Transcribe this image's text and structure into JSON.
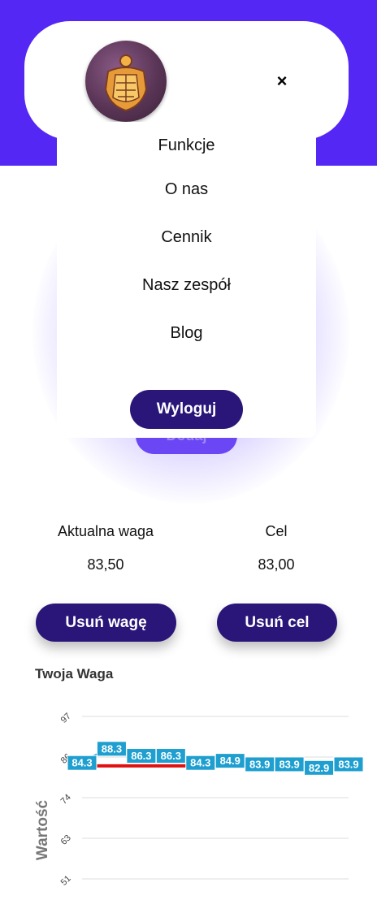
{
  "header": {
    "close_label": "×"
  },
  "menu": {
    "items": [
      "Funkcje",
      "O nas",
      "Cennik",
      "Nasz zespół",
      "Blog"
    ],
    "logout_label": "Wyloguj"
  },
  "background_button_label": "Dodaj",
  "stats": {
    "current_weight_label": "Aktualna waga",
    "current_weight_value": "83,50",
    "goal_label": "Cel",
    "goal_value": "83,00"
  },
  "actions": {
    "remove_weight_label": "Usuń wagę",
    "remove_goal_label": "Usuń cel"
  },
  "chart_title": "Twoja Waga",
  "chart_data": {
    "type": "line",
    "title": "Twoja Waga",
    "ylabel": "Wartość",
    "xlabel": "",
    "y_ticks": [
      "97",
      "86",
      "74",
      "63",
      "51"
    ],
    "ylim": [
      51,
      97
    ],
    "values": [
      84.3,
      88.3,
      86.3,
      86.3,
      84.3,
      84.9,
      83.9,
      83.9,
      82.9,
      83.9
    ],
    "data_labels": [
      "84.3",
      "88.3",
      "86.3",
      "86.3",
      "84.3",
      "84.9",
      "83.9",
      "83.9",
      "82.9",
      "83.9"
    ],
    "goal_line": 83.0,
    "colors": {
      "labels": "#1e9fd0",
      "goal": "#e01010",
      "line": "#1e9fd0"
    }
  }
}
